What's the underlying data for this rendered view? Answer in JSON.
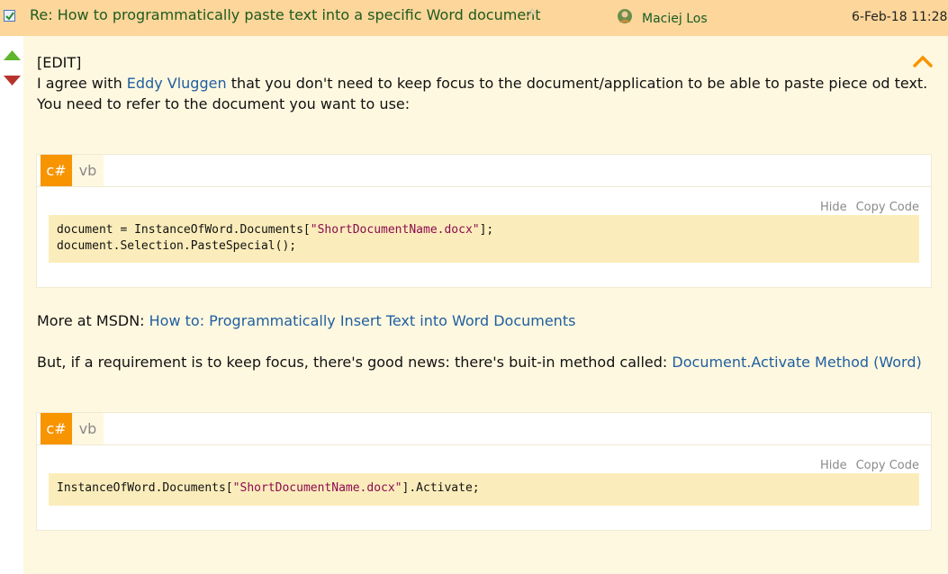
{
  "header": {
    "subject": "Re: How to programmatically paste text into a specific Word document",
    "author": "Maciej Los",
    "date": "6-Feb-18 11:28"
  },
  "icons": {
    "checkbox": "checkbox-icon",
    "pin": "pin-icon",
    "avatar": "member-avatar-icon",
    "vote_up": "vote-up-icon",
    "vote_down": "vote-down-icon",
    "collapse": "chevron-up-icon"
  },
  "colors": {
    "header_bg": "#fcd69a",
    "post_bg": "#fff8e0",
    "code_bg": "#fbedbb",
    "tab_active": "#f79400",
    "link": "#1f5fa0",
    "string": "#8b0a50"
  },
  "body": {
    "edit": "[EDIT]",
    "line1_prefix": "I agree with ",
    "line1_link": "Eddy Vluggen",
    "line1_suffix": " that you don't need to keep focus to the document/application to be able to paste piece od text.",
    "line2": "You need to refer to the document you want to use:",
    "msdn_prefix": "More at MSDN: ",
    "msdn_link": "How to: Programmatically Insert Text into Word Documents",
    "but_prefix": "But, if a requirement is to keep focus, there's good news: there's buit-in method called: ",
    "but_link": "Document.Activate Method (Word)"
  },
  "code1": {
    "tab_cs": "c#",
    "tab_vb": "vb",
    "hide": "Hide",
    "copy": "Copy Code",
    "l1_pre": "document = InstanceOfWord.Documents[",
    "l1_str": "\"ShortDocumentName.docx\"",
    "l1_post": "];",
    "l2": "document.Selection.PasteSpecial();"
  },
  "code2": {
    "tab_cs": "c#",
    "tab_vb": "vb",
    "hide": "Hide",
    "copy": "Copy Code",
    "l1_pre": "InstanceOfWord.Documents[",
    "l1_str": "\"ShortDocumentName.docx\"",
    "l1_post": "].Activate;"
  }
}
